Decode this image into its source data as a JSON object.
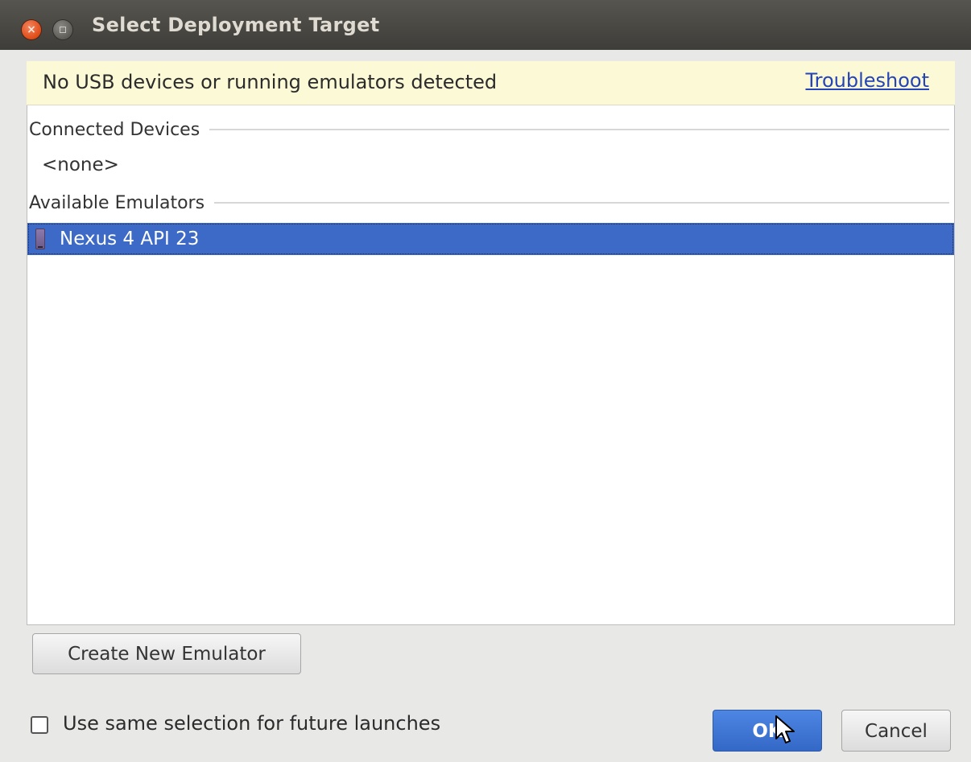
{
  "window": {
    "title": "Select Deployment Target",
    "close_glyph": "×",
    "close_icon": "close-icon",
    "maximize_icon": "maximize-icon"
  },
  "banner": {
    "message": "No USB devices or running emulators detected",
    "link": "Troubleshoot",
    "background": "#fcf9d6",
    "link_color": "#2544b6"
  },
  "sections": {
    "connected": {
      "label": "Connected Devices",
      "empty_text": "<none>"
    },
    "emulators": {
      "label": "Available Emulators",
      "items": [
        {
          "label": "Nexus 4 API 23",
          "icon": "phone-icon",
          "selected": true
        }
      ]
    }
  },
  "buttons": {
    "create": "Create New Emulator",
    "ok": "OK",
    "cancel": "Cancel"
  },
  "options": {
    "same_selection_label": "Use same selection for future launches",
    "same_selection_checked": false
  },
  "colors": {
    "selection": "#3c6ac6",
    "ok_button": "#3d74d6"
  }
}
